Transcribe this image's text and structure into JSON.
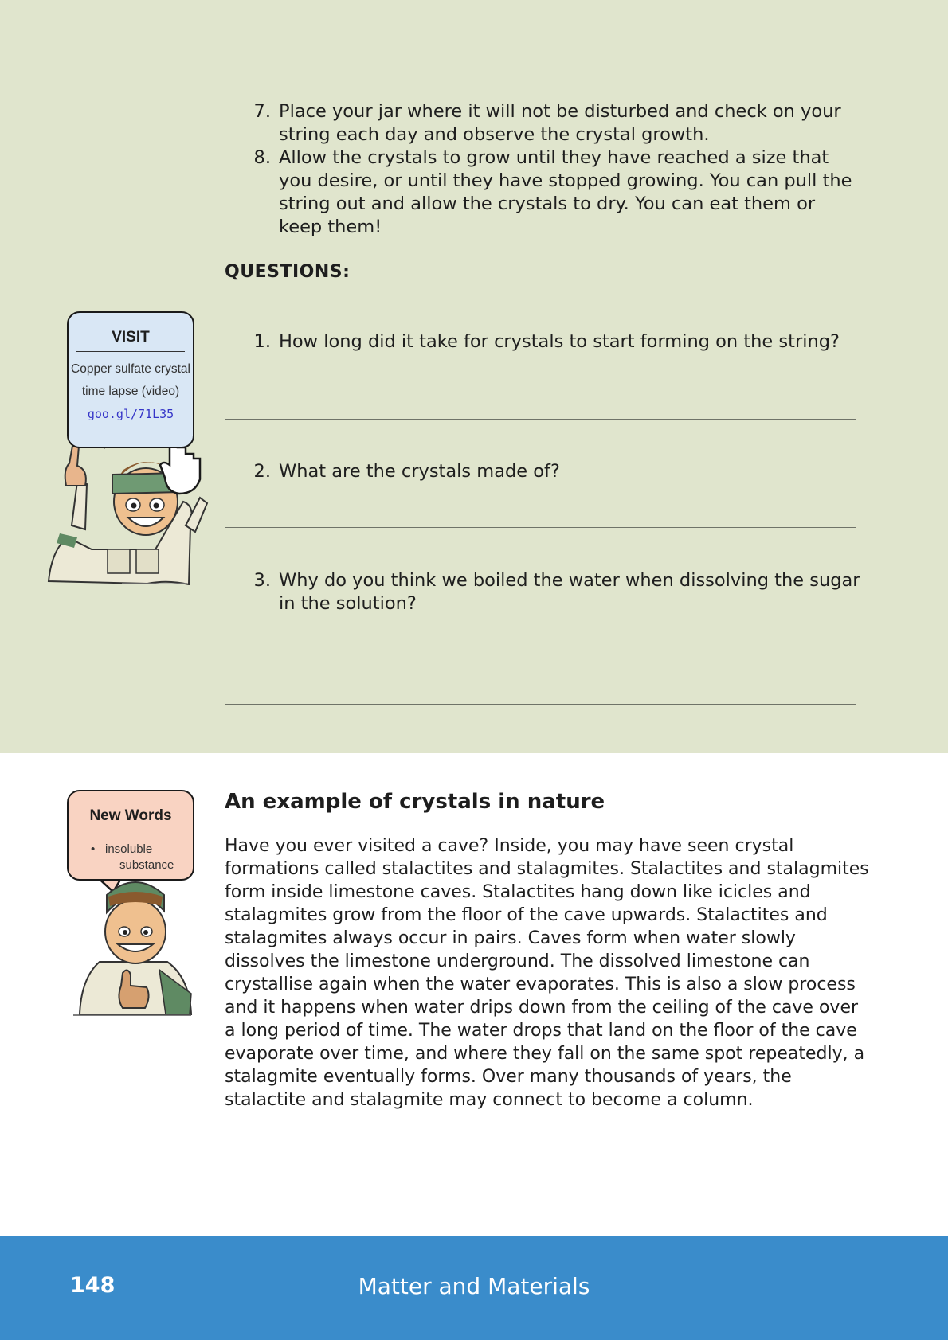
{
  "steps": [
    {
      "num": "7.",
      "text": "Place your jar where it will not be disturbed and check on your string each day and observe the crystal growth."
    },
    {
      "num": "8.",
      "text": "Allow the crystals to grow until they have reached a size that you desire, or until they have stopped growing. You can pull the string out and allow the crystals to dry. You can eat them or keep them!"
    }
  ],
  "questions_heading": "QUESTIONS:",
  "questions": [
    {
      "num": "1.",
      "text": "How long did it take for crystals to start forming on the string?"
    },
    {
      "num": "2.",
      "text": "What are the crystals made of?"
    },
    {
      "num": "3.",
      "text": "Why do you think we boiled the water when dissolving the sugar in the solution?"
    }
  ],
  "visit_box": {
    "title": "VISIT",
    "line1": "Copper sulfate crystal",
    "line2": "time lapse (video)",
    "link": "goo.gl/71L35"
  },
  "new_words_box": {
    "title": "New Words",
    "items": [
      "insoluble",
      "substance"
    ]
  },
  "section": {
    "title": "An example of crystals in nature",
    "body": "Have you ever visited a cave? Inside, you may have seen crystal formations called stalactites and stalagmites. Stalactites and stalagmites form inside limestone caves. Stalactites hang down like icicles and stalagmites grow from the floor of the cave upwards. Stalactites and stalagmites always occur in pairs. Caves form when water slowly dissolves the limestone underground. The dissolved limestone can crystallise again when the water evaporates. This is also a slow process and it happens when water drips down from the ceiling of the cave over a long period of time. The water drops that land on the floor of the cave evaporate over time, and where they fall on the same spot repeatedly, a stalagmite eventually forms. Over many thousands of years, the stalactite and stalagmite may connect to become a column."
  },
  "footer": {
    "page_number": "148",
    "title": "Matter and Materials"
  },
  "colors": {
    "panel_green": "#e0e5cd",
    "footer_blue": "#3a8ccb",
    "visit_bubble": "#d9e7f5",
    "words_bubble": "#f9d3c2",
    "link_blue": "#3535c8"
  }
}
